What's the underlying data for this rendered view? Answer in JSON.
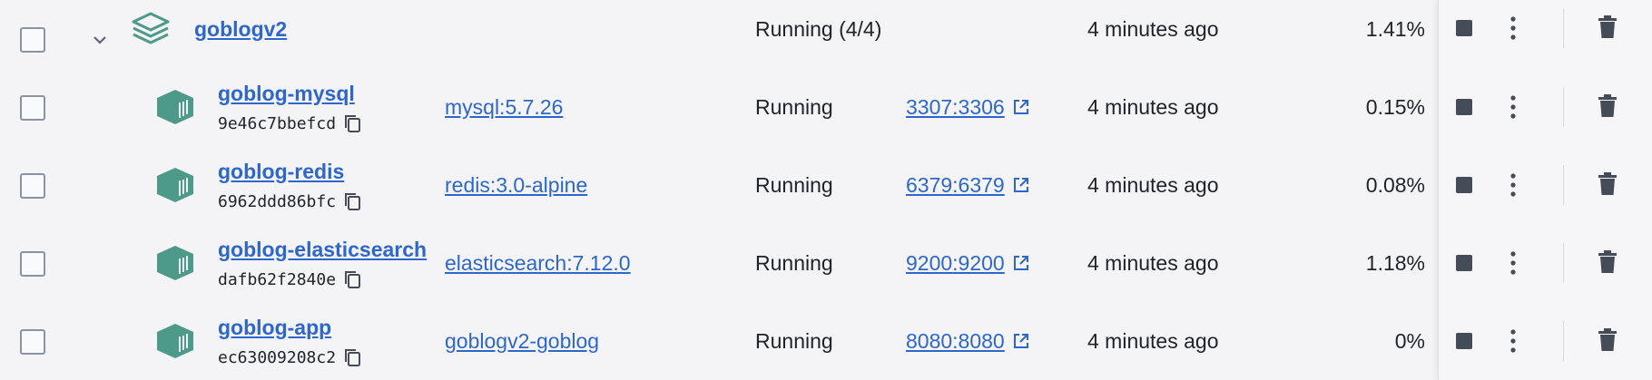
{
  "project": {
    "name": "goblogv2",
    "status": "Running (4/4)",
    "last_started": "4 minutes ago",
    "cpu": "1.41%"
  },
  "containers": [
    {
      "name": "goblog-mysql",
      "id": "9e46c7bbefcd",
      "image": "mysql:5.7.26",
      "status": "Running",
      "port": "3307:3306",
      "last_started": "4 minutes ago",
      "cpu": "0.15%"
    },
    {
      "name": "goblog-redis",
      "id": "6962ddd86bfc",
      "image": "redis:3.0-alpine",
      "status": "Running",
      "port": "6379:6379",
      "last_started": "4 minutes ago",
      "cpu": "0.08%"
    },
    {
      "name": "goblog-elasticsearch",
      "id": "dafb62f2840e",
      "image": "elasticsearch:7.12.0",
      "status": "Running",
      "port": "9200:9200",
      "last_started": "4 minutes ago",
      "cpu": "1.18%"
    },
    {
      "name": "goblog-app",
      "id": "ec63009208c2",
      "image": "goblogv2-goblog",
      "status": "Running",
      "port": "8080:8080",
      "last_started": "4 minutes ago",
      "cpu": "0%"
    }
  ],
  "colors": {
    "link": "#2e67c9",
    "icon_teal": "#4e9a8a",
    "action_icon": "#454b57",
    "checkbox_border": "#8b93a2"
  },
  "icons": {
    "expand": "chevron-down-icon",
    "project": "stack-layers-icon",
    "container": "container-cube-icon",
    "copy": "copy-icon",
    "open_port": "external-link-icon",
    "stop": "stop-icon",
    "more": "kebab-menu-icon",
    "delete": "trash-icon"
  }
}
